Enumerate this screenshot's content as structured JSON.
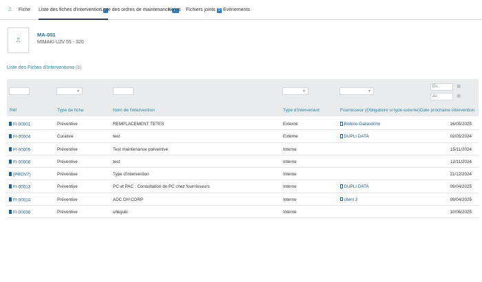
{
  "tabs": [
    {
      "label": "Fiche",
      "active": false
    },
    {
      "label": "Liste des fiches d'intervention",
      "badge": "8",
      "active": true
    },
    {
      "label": "Liste des ordres de maintenance",
      "badge": "12",
      "active": false
    },
    {
      "label": "Notes",
      "active": false
    },
    {
      "label": "Fichiers joints",
      "badge": "0",
      "active": false
    },
    {
      "label": "Evénements",
      "active": false
    }
  ],
  "equipment": {
    "code": "MA-001",
    "name": "MIMAKI UJV 55 - 320"
  },
  "list": {
    "title": "Liste des Fiches d'Interventions",
    "count": "(8)"
  },
  "filters": {
    "date_from_placeholder": "Du",
    "date_to_placeholder": "au"
  },
  "columns": {
    "ref": "Réf",
    "type": "Type de fiche",
    "name": "Nom de l'intervention",
    "intervenant": "Type d'intervenant",
    "supplier": "Fournisseur (Obligatoire si type externe)",
    "date": "Date prochaine intervention"
  },
  "rows": [
    {
      "ref": "FI-00001",
      "type": "Préventive",
      "name": "REMPLACEMENT TETES",
      "intervenant": "Externe",
      "supplier": "Robino-Galandrino",
      "date": "16/05/2025"
    },
    {
      "ref": "FI-00004",
      "type": "Curative",
      "name": "test",
      "intervenant": "Externe",
      "supplier": "DUPLI DATA",
      "date": "02/05/2024"
    },
    {
      "ref": "FI-00005",
      "type": "Préventive",
      "name": "Test maintenance préventive",
      "intervenant": "Interne",
      "supplier": "",
      "date": "15/11/2024"
    },
    {
      "ref": "FI-00006",
      "type": "Préventive",
      "name": "test",
      "intervenant": "Interne",
      "supplier": "",
      "date": "12/11/2024"
    },
    {
      "ref": "(PROV7)",
      "type": "Préventive",
      "name": "Type d'intervention",
      "intervenant": "Interne",
      "supplier": "",
      "date": "21/12/2024"
    },
    {
      "ref": "FI-00013",
      "type": "Préventive",
      "name": "PC et PAC : Consultation de PC chez fournisseurs",
      "intervenant": "Interne",
      "supplier": "DUPLI DATA",
      "date": "09/04/2025"
    },
    {
      "ref": "FI-00014",
      "type": "Préventive",
      "name": "ADC DH CORP",
      "intervenant": "Interne",
      "supplier": "client 2",
      "date": "09/04/2025"
    },
    {
      "ref": "FI-00036",
      "type": "Préventive",
      "name": "uhkguki",
      "intervenant": "Interne",
      "supplier": "",
      "date": "10/06/2025"
    }
  ],
  "icons": {
    "fiche_tab": "machine-icon",
    "equipment": "machine-icon",
    "ref": "document-icon",
    "supplier": "company-icon",
    "date_picker": "calendar-icon"
  },
  "colors": {
    "accent": "#1a7596",
    "link": "#1b5e9b",
    "badge": "#2f7fbf",
    "filter_band": "#e9ebed"
  }
}
